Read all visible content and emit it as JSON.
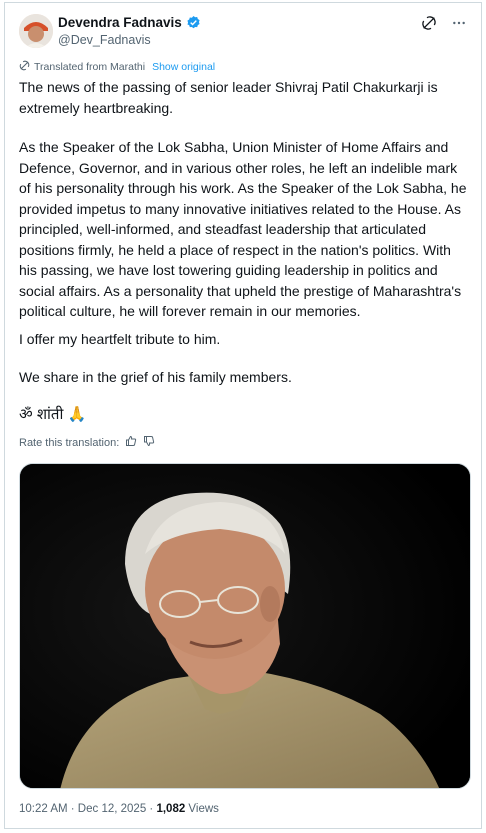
{
  "author": {
    "name": "Devendra Fadnavis",
    "handle": "@Dev_Fadnavis",
    "verified_color": "#1d9bf0"
  },
  "header_icons": [
    "grok-icon",
    "more-icon"
  ],
  "translation": {
    "label": "Translated from Marathi",
    "show_original": "Show original"
  },
  "post": {
    "p1": "The news of the passing of senior leader Shivraj Patil Chakurkarji is extremely heartbreaking.",
    "p2": "As the Speaker of the Lok Sabha, Union Minister of Home Affairs and Defence, Governor, and in various other roles, he left an indelible mark of his personality through his work. As the Speaker of the Lok Sabha, he provided impetus to many innovative initiatives related to the House. As principled, well-informed, and steadfast leadership that articulated positions firmly, he held a place of respect in the nation's politics. With his passing, we have lost towering guiding leadership in politics and social affairs. As a personality that upheld the prestige of Maharashtra's political culture, he will forever remain in our memories.",
    "p3": "I offer my heartfelt tribute to him.",
    "p4": "We share in the grief of his family members.",
    "p5": "ॐ शांती 🙏"
  },
  "rate": {
    "label": "Rate this translation:",
    "icons": [
      "thumbs-up-icon",
      "thumbs-down-icon"
    ]
  },
  "media": {
    "alt": "photo"
  },
  "footer": {
    "time": "10:22 AM · Dec 12, 2025 · ",
    "views_count": "1,082",
    "views_label": " Views"
  }
}
